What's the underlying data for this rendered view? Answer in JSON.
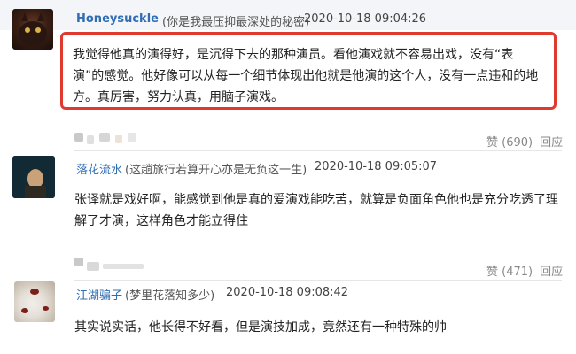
{
  "comments": [
    {
      "username": "Honeysuckle",
      "signature": "(你是我最压抑最深处的秘密)",
      "time": "2020-10-18 09:04:26",
      "content": "我觉得他真的演得好，是沉得下去的那种演员。看他演戏就不容易出戏，没有“表演”的感觉。他好像可以从每一个细节体现出他就是他演的这个人，没有一点违和的地方。真厉害，努力认真，用脑子演戏。",
      "like_label": "赞 (690)",
      "reply_label": "回应"
    },
    {
      "username": "落花流水",
      "signature": "(这趟旅行若算开心亦是无负这一生)",
      "time": "2020-10-18 09:05:07",
      "content": "张译就是戏好啊，能感觉到他是真的爱演戏能吃苦，就算是负面角色他也是充分吃透了理解了才演，这样角色才能立得住",
      "like_label": "赞 (471)",
      "reply_label": "回应"
    },
    {
      "username": "江湖骗子",
      "signature": "(梦里花落知多少)",
      "time": "2020-10-18 09:08:42",
      "content": "其实说实话，他长得不好看，但是演技加成，竟然还有一种特殊的帅"
    }
  ],
  "colors": {
    "username": "#2f6db4",
    "highlight_border": "#e03a2f",
    "action_text": "#888888"
  }
}
